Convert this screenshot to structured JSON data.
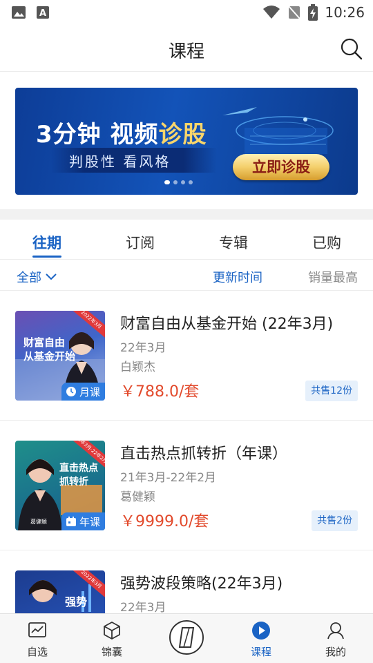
{
  "status_bar": {
    "time": "10:26"
  },
  "header": {
    "title": "课程"
  },
  "banner": {
    "headline_white": "3分钟 视频",
    "headline_gold": "诊股",
    "subtitle": "判股性  看风格",
    "cta": "立即诊股",
    "slide_count": 4,
    "active_slide": 1
  },
  "tabs": [
    {
      "label": "往期",
      "active": true
    },
    {
      "label": "订阅",
      "active": false
    },
    {
      "label": "专辑",
      "active": false
    },
    {
      "label": "已购",
      "active": false
    }
  ],
  "filter": {
    "all_label": "全部",
    "sort_time": "更新时间",
    "sort_sales": "销量最高"
  },
  "courses": [
    {
      "thumb_text": "财富自由\n从基金开始",
      "thumb_badge": "月课",
      "thumb_corner": "2022年3月",
      "title": "财富自由从基金开始 (22年3月)",
      "period": "22年3月",
      "teacher": "白颖杰",
      "price": "￥788.0/套",
      "sold": "共售12份"
    },
    {
      "thumb_text": "直击热点\n抓转折",
      "thumb_badge": "年课",
      "thumb_corner": "21年3月-22年2月",
      "thumb_name": "葛健颖",
      "title": "直击热点抓转折（年课）",
      "period": "21年3月-22年2月",
      "teacher": "葛健颖",
      "price": "￥9999.0/套",
      "sold": "共售2份"
    },
    {
      "thumb_text": "强势",
      "thumb_corner": "2022年3月",
      "title": "强势波段策略(22年3月)",
      "period": "22年3月"
    }
  ],
  "bottom_nav": [
    {
      "label": "自选",
      "icon": "chart-icon"
    },
    {
      "label": "锦囊",
      "icon": "box-icon"
    },
    {
      "label": "",
      "icon": "logo-icon"
    },
    {
      "label": "课程",
      "icon": "play-circle-icon",
      "active": true
    },
    {
      "label": "我的",
      "icon": "user-icon"
    }
  ],
  "colors": {
    "accent": "#1a63c4",
    "price": "#e24a2c",
    "banner_bg": "#1353b8",
    "banner_gold": "#f8d56b"
  }
}
